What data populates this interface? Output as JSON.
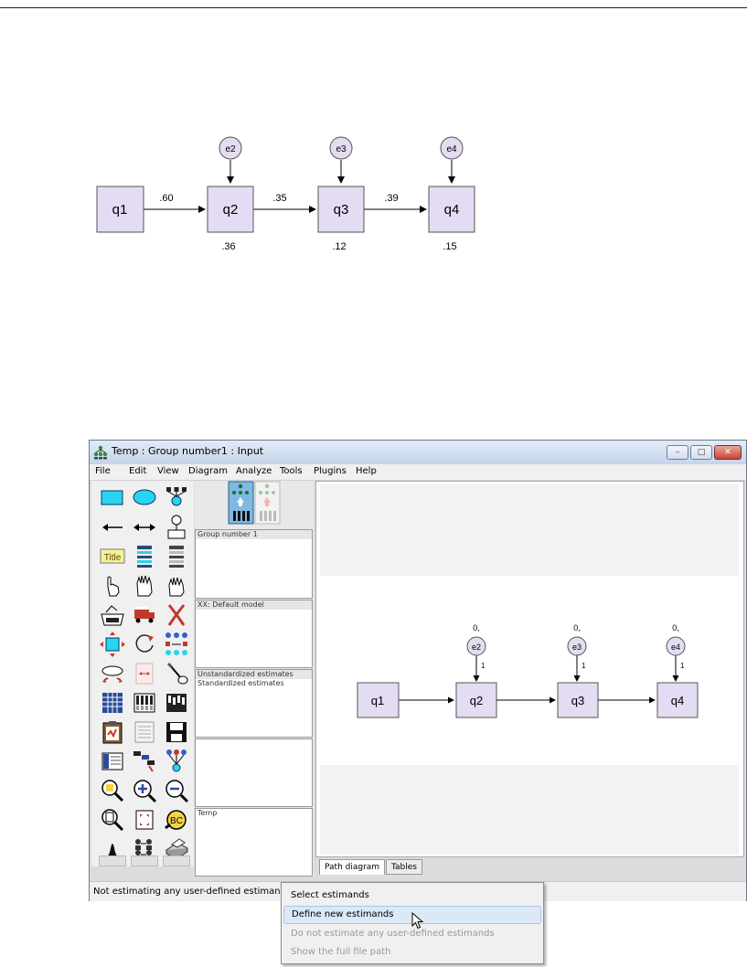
{
  "figure1": {
    "nodes": [
      {
        "id": "q1",
        "label": "q1"
      },
      {
        "id": "q2",
        "label": "q2"
      },
      {
        "id": "q3",
        "label": "q3"
      },
      {
        "id": "q4",
        "label": "q4"
      }
    ],
    "errors": [
      {
        "id": "e2",
        "label": "e2",
        "target": "q2"
      },
      {
        "id": "e3",
        "label": "e3",
        "target": "q3"
      },
      {
        "id": "e4",
        "label": "e4",
        "target": "q4"
      }
    ],
    "paths": [
      {
        "from": "q1",
        "to": "q2",
        "coef": ".60"
      },
      {
        "from": "q2",
        "to": "q3",
        "coef": ".35"
      },
      {
        "from": "q3",
        "to": "q4",
        "coef": ".39"
      }
    ],
    "r2": [
      {
        "node": "q2",
        "value": ".36"
      },
      {
        "node": "q3",
        "value": ".12"
      },
      {
        "node": "q4",
        "value": ".15"
      }
    ]
  },
  "window": {
    "title": "Temp : Group number1 : Input",
    "controls": {
      "minimize": "–",
      "maximize": "□",
      "close": "✕"
    },
    "menu": [
      "File",
      "Edit",
      "View",
      "Diagram",
      "Analyze",
      "Tools",
      "Plugins",
      "Help"
    ],
    "panes": {
      "groups": [
        "Group number 1"
      ],
      "models": [
        "XX: Default model"
      ],
      "estimates": [
        "Unstandardized estimates",
        "Standardized estimates"
      ],
      "file": [
        "Temp"
      ]
    },
    "diagram": {
      "nodes": [
        "q1",
        "q2",
        "q3",
        "q4"
      ],
      "errors": [
        {
          "label": "e2",
          "mean": "0,",
          "loading": "1"
        },
        {
          "label": "e3",
          "mean": "0,",
          "loading": "1"
        },
        {
          "label": "e4",
          "mean": "0,",
          "loading": "1"
        }
      ]
    },
    "tabs": [
      "Path diagram",
      "Tables"
    ],
    "status": "Not estimating any user-defined estimand.",
    "colors": {
      "node_fill": "#e3dcf2",
      "tool_cyan": "#2ad3f0",
      "title_tool": "#f4f19a",
      "ctx_highlight": "#dbe8f6"
    }
  },
  "context_menu": {
    "items": [
      {
        "label": "Select estimands",
        "state": "enabled"
      },
      {
        "label": "Define new estimands",
        "state": "highlighted"
      },
      {
        "label": "Do not estimate any user-defined estimands",
        "state": "disabled"
      },
      {
        "label": "Show the full file path",
        "state": "disabled"
      }
    ]
  },
  "icons": {
    "app": "amos-app-icon",
    "tools": [
      "rectangle-icon",
      "ellipse-icon",
      "indicator-icon",
      "single-arrow-icon",
      "double-arrow-icon",
      "unique-variable-icon",
      "title-icon",
      "list-variables-icon",
      "list-data-icon",
      "select-one-icon",
      "select-all-icon",
      "deselect-icon",
      "duplicate-icon",
      "move-icon",
      "erase-icon",
      "shape-change-icon",
      "rotate-icon",
      "reflect-icon",
      "parameter-move-icon",
      "scroll-icon",
      "touch-up-icon",
      "data-files-icon",
      "analysis-properties-icon",
      "calculate-estimates-icon",
      "clipboard-icon",
      "text-output-icon",
      "save-icon",
      "object-properties-icon",
      "drag-properties-icon",
      "preserve-symmetries-icon",
      "zoom-select-icon",
      "zoom-in-icon",
      "zoom-out-icon",
      "page-icon",
      "fit-page-icon",
      "loupe-icon",
      "bayesian-icon",
      "multigroup-icon",
      "print-icon"
    ]
  }
}
